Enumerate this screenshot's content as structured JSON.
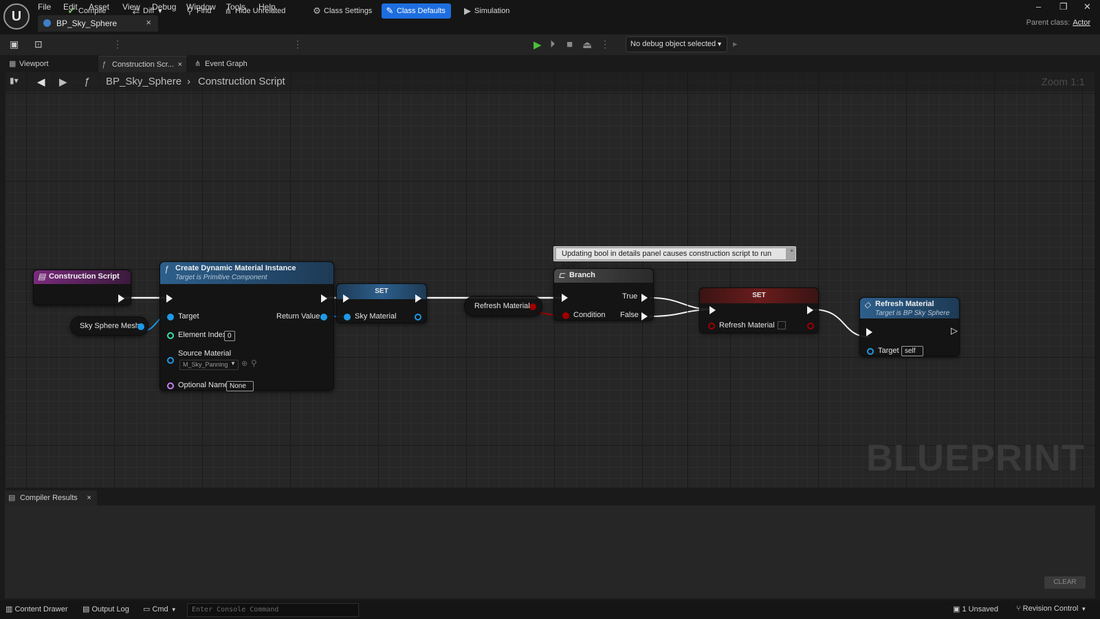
{
  "menu": [
    "File",
    "Edit",
    "Asset",
    "View",
    "Debug",
    "Window",
    "Tools",
    "Help"
  ],
  "logo_text": "U",
  "document_tab": {
    "label": "BP_Sky_Sphere",
    "close": "×"
  },
  "window_controls": {
    "minimize": "–",
    "restore": "❐",
    "close": "✕"
  },
  "parent_class": {
    "label": "Parent class:",
    "value": "Actor"
  },
  "toolbar": {
    "compile": "Compile",
    "diff": "Diff",
    "find": "Find",
    "hide_unrelated": "Hide Unrelated",
    "class_settings": "Class Settings",
    "class_defaults": "Class Defaults",
    "simulation": "Simulation",
    "debug_select": "No debug object selected"
  },
  "view_tabs": {
    "viewport": "Viewport",
    "construction": "Construction Scr...",
    "event_graph": "Event Graph"
  },
  "breadcrumb": {
    "root": "BP_Sky_Sphere",
    "sep": "›",
    "current": "Construction Script"
  },
  "zoom": "Zoom 1:1",
  "watermark": "BLUEPRINT",
  "comment": "Updating bool in details panel causes construction script to run again",
  "nodes": {
    "construction_script": {
      "title": "Construction Script"
    },
    "sky_sphere_mesh": {
      "title": "Sky Sphere Mesh"
    },
    "create_dmi": {
      "title": "Create Dynamic Material Instance",
      "subtitle": "Target is Primitive Component",
      "target": "Target",
      "return_value": "Return Value",
      "element_index": "Element Index",
      "element_index_value": "0",
      "source_material": "Source Material",
      "source_material_value": "M_Sky_Panning",
      "optional_name": "Optional Name",
      "optional_name_value": "None"
    },
    "set_sky": {
      "title": "SET",
      "pin": "Sky Material"
    },
    "refresh_getter": {
      "title": "Refresh Material"
    },
    "branch": {
      "title": "Branch",
      "true": "True",
      "false": "False",
      "condition": "Condition"
    },
    "set_refresh": {
      "title": "SET",
      "pin": "Refresh Material"
    },
    "refresh_call": {
      "title": "Refresh Material",
      "subtitle": "Target is BP Sky Sphere",
      "target": "Target",
      "target_value": "self"
    }
  },
  "compiler": {
    "tab": "Compiler Results",
    "clear": "CLEAR"
  },
  "statusbar": {
    "content_drawer": "Content Drawer",
    "output_log": "Output Log",
    "cmd": "Cmd",
    "console_placeholder": "Enter Console Command",
    "unsaved": "1 Unsaved",
    "revision_control": "Revision Control"
  },
  "colors": {
    "accent": "#1d6ee0",
    "function_header": "#2d5f8c",
    "event_header": "#7a2a7c",
    "exec": "#f2f2f2",
    "object_pin": "#1e9ae6",
    "bool_pin": "#a00000",
    "name_pin": "#c880f0",
    "int_pin": "#3fe0a8"
  }
}
